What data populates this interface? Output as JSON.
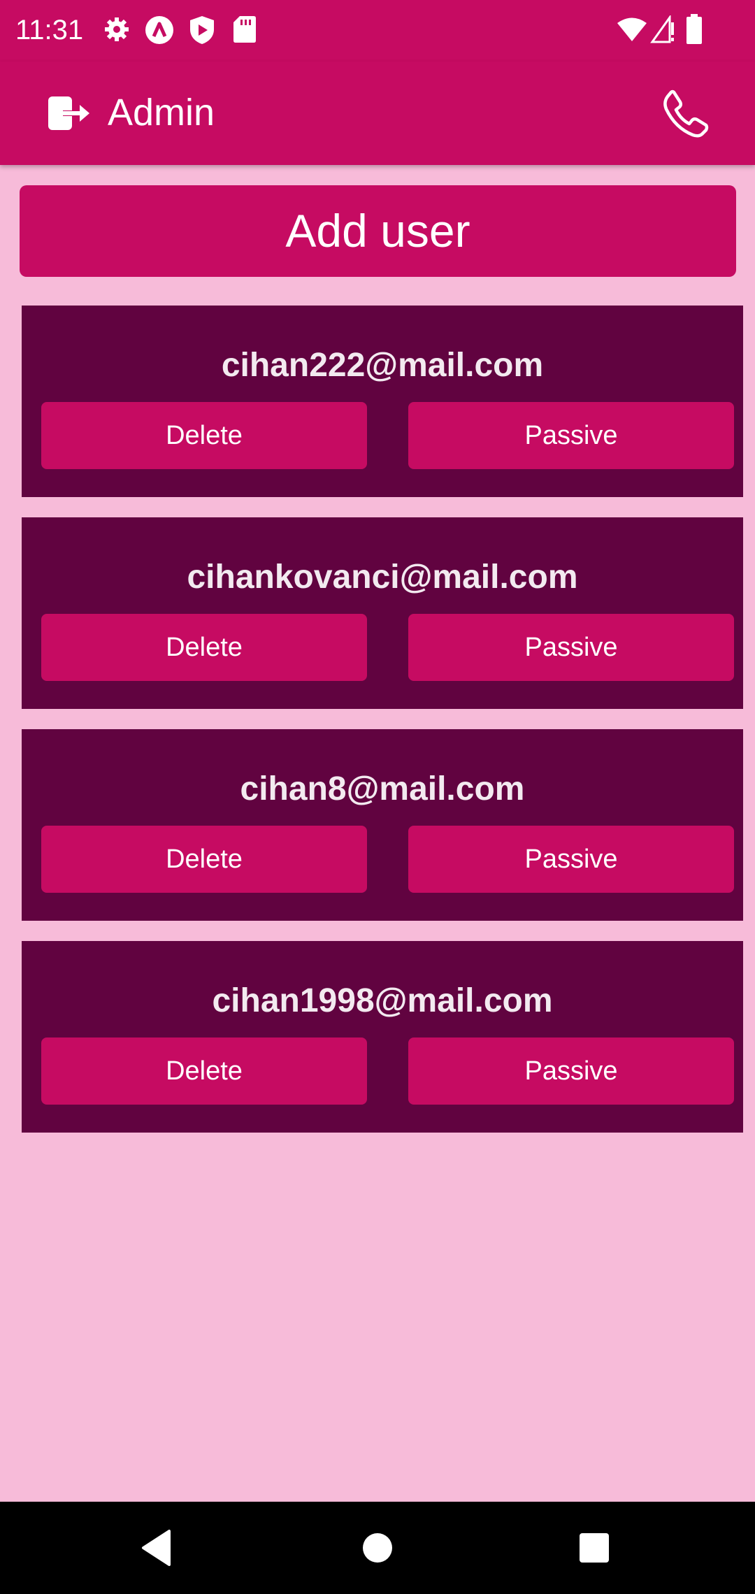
{
  "status_bar": {
    "time": "11:31",
    "left_icons": [
      "gear-icon",
      "accessibility-icon",
      "play-shield-icon",
      "sd-card-icon"
    ],
    "right_icons": [
      "wifi-icon",
      "signal-icon",
      "battery-icon"
    ]
  },
  "app_bar": {
    "title": "Admin",
    "left_icon": "logout-icon",
    "right_icon": "phone-icon"
  },
  "add_user_label": "Add user",
  "users": [
    {
      "email": "cihan222@mail.com",
      "delete_label": "Delete",
      "passive_label": "Passive"
    },
    {
      "email": "cihankovanci@mail.com",
      "delete_label": "Delete",
      "passive_label": "Passive"
    },
    {
      "email": "cihan8@mail.com",
      "delete_label": "Delete",
      "passive_label": "Passive"
    },
    {
      "email": "cihan1998@mail.com",
      "delete_label": "Delete",
      "passive_label": "Passive"
    }
  ],
  "nav_bar": {
    "icons": [
      "back-icon",
      "home-icon",
      "recents-icon"
    ]
  },
  "colors": {
    "primary": "#c60b62",
    "card": "#610340",
    "background": "#f7bbd9",
    "navbar": "#000000"
  }
}
